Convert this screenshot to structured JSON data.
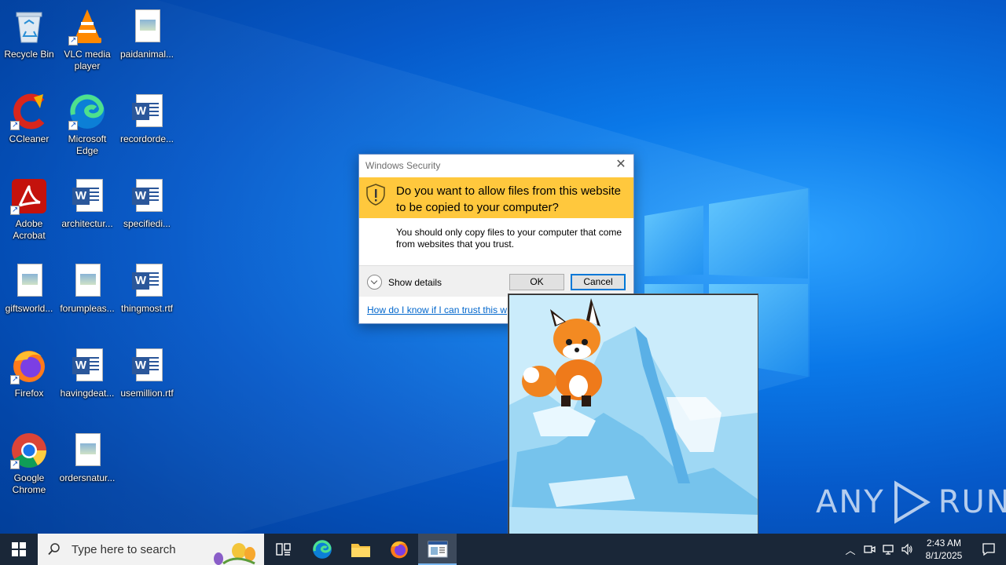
{
  "desktop": {
    "icons": [
      {
        "label": "Recycle Bin",
        "icon": "recycle-bin-icon"
      },
      {
        "label": "VLC media player",
        "icon": "vlc-icon"
      },
      {
        "label": "paidanimal...",
        "icon": "image-file-icon"
      },
      {
        "label": "CCleaner",
        "icon": "ccleaner-icon"
      },
      {
        "label": "Microsoft Edge",
        "icon": "edge-icon"
      },
      {
        "label": "recordorde...",
        "icon": "word-doc-icon"
      },
      {
        "label": "Adobe Acrobat",
        "icon": "acrobat-icon"
      },
      {
        "label": "architectur...",
        "icon": "word-doc-icon"
      },
      {
        "label": "specifiedi...",
        "icon": "word-doc-icon"
      },
      {
        "label": "giftsworld...",
        "icon": "image-file-icon"
      },
      {
        "label": "forumpleas...",
        "icon": "image-file-icon"
      },
      {
        "label": "thingmost.rtf",
        "icon": "word-doc-icon"
      },
      {
        "label": "Firefox",
        "icon": "firefox-icon"
      },
      {
        "label": "havingdeat...",
        "icon": "word-doc-icon"
      },
      {
        "label": "usemillion.rtf",
        "icon": "word-doc-icon"
      },
      {
        "label": "Google Chrome",
        "icon": "chrome-icon"
      },
      {
        "label": "ordersnatur...",
        "icon": "image-file-icon"
      }
    ]
  },
  "dialog": {
    "title": "Windows Security",
    "question": "Do you want to allow files from this website to be copied to your computer?",
    "body": "You should only copy files to your computer that come from websites that you trust.",
    "details_label": "Show details",
    "ok_label": "OK",
    "cancel_label": "Cancel",
    "help_link": "How do I know if I can trust this w",
    "banner_color": "#ffc83d"
  },
  "watermark": {
    "left": "ANY",
    "right": "RUN"
  },
  "taskbar": {
    "search_placeholder": "Type here to search",
    "time": "2:43 AM",
    "date": "8/1/2025",
    "color": "#1a2738"
  }
}
